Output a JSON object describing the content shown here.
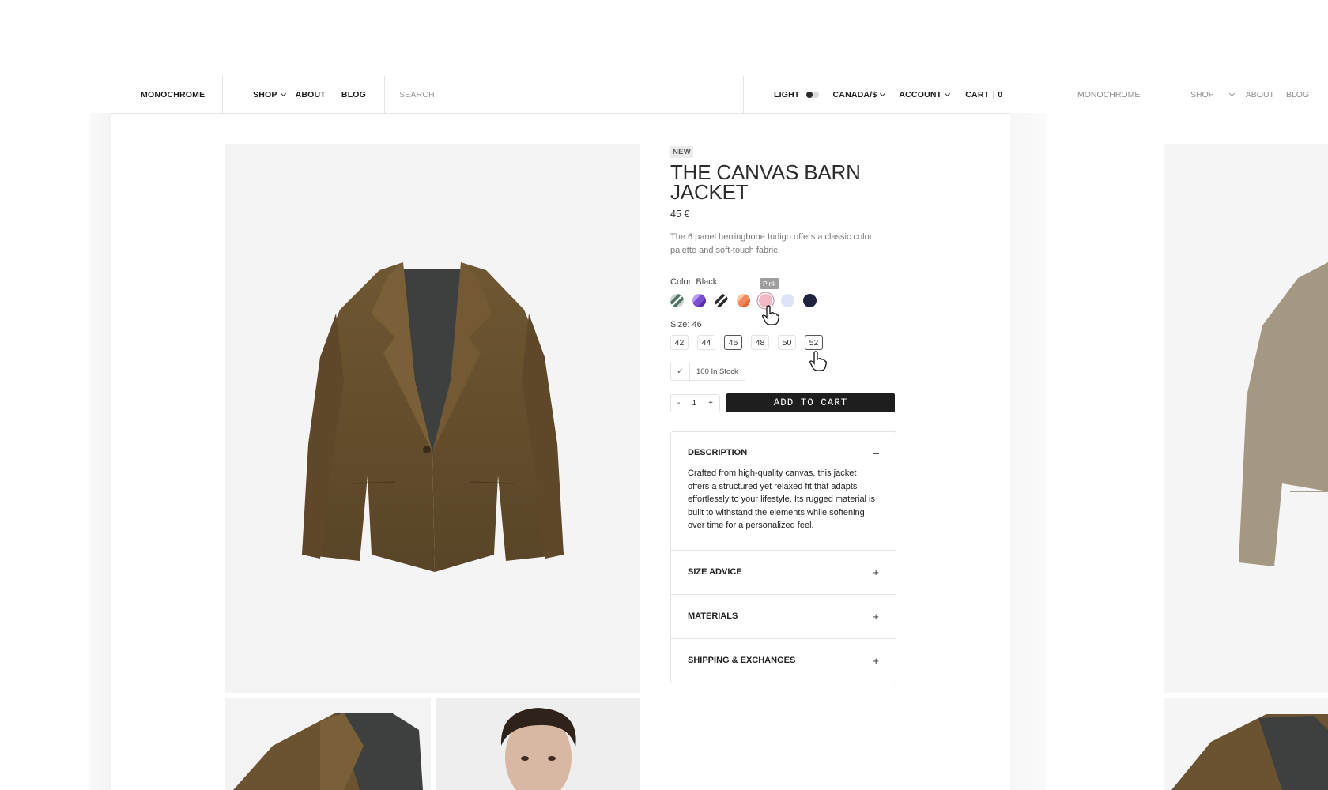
{
  "header": {
    "logo": "MONOCHROME",
    "nav": {
      "shop": "SHOP",
      "about": "ABOUT",
      "blog": "BLOG"
    },
    "search_placeholder": "SEARCH",
    "light_label": "LIGHT",
    "region": "CANADA/$",
    "account": "ACCOUNT",
    "cart_label": "CART",
    "cart_count": "0"
  },
  "ghost_header": {
    "logo": "MONOCHROME",
    "nav": {
      "shop": "SHOP",
      "about": "ABOUT",
      "blog": "BLOG"
    }
  },
  "product": {
    "badge": "NEW",
    "title_line1": "THE CANVAS BARN",
    "title_line2": "JACKET",
    "price": "45  €",
    "description": "The 6 panel herringbone Indigo offers a classic color palette and soft-touch fabric.",
    "color_label": "Color: Black",
    "tooltip": "Pink",
    "swatches": [
      {
        "name": "green-stripe",
        "color": "#4f6f5f"
      },
      {
        "name": "purple",
        "color": "#7c4fd0"
      },
      {
        "name": "black-white-stripe",
        "color": "#2b2b2b"
      },
      {
        "name": "orange",
        "color": "#f08a5d"
      },
      {
        "name": "pink",
        "color": "#f2b8c6"
      },
      {
        "name": "light-lavender",
        "color": "#dfe3f8"
      },
      {
        "name": "navy",
        "color": "#1f2340"
      }
    ],
    "size_label": "Size: 46",
    "sizes": [
      "42",
      "44",
      "46",
      "48",
      "50",
      "52"
    ],
    "selected_size": "46",
    "hovered_size": "52",
    "stock_check": "✓",
    "stock_text": "100 In Stock",
    "qty_minus": "-",
    "qty_value": "1",
    "qty_plus": "+",
    "add_to_cart": "ADD TO CART"
  },
  "accordion": {
    "description": {
      "title": "DESCRIPTION",
      "symbol": "–",
      "body": "Crafted from high-quality canvas, this jacket offers a structured yet relaxed fit that adapts effortlessly to your lifestyle. Its rugged material is built to withstand the elements while softening over time for a personalized feel."
    },
    "size_advice": {
      "title": "SIZE ADVICE",
      "symbol": "+"
    },
    "materials": {
      "title": "MATERIALS",
      "symbol": "+"
    },
    "shipping": {
      "title": "SHIPPING & EXCHANGES",
      "symbol": "+"
    }
  },
  "colors": {
    "jacket": "#6b5331",
    "jacket_shadow": "#4a3a22",
    "lining": "#3d403f",
    "ghost_jacket": "#a49883",
    "button_dark": "#1e1e1e"
  }
}
